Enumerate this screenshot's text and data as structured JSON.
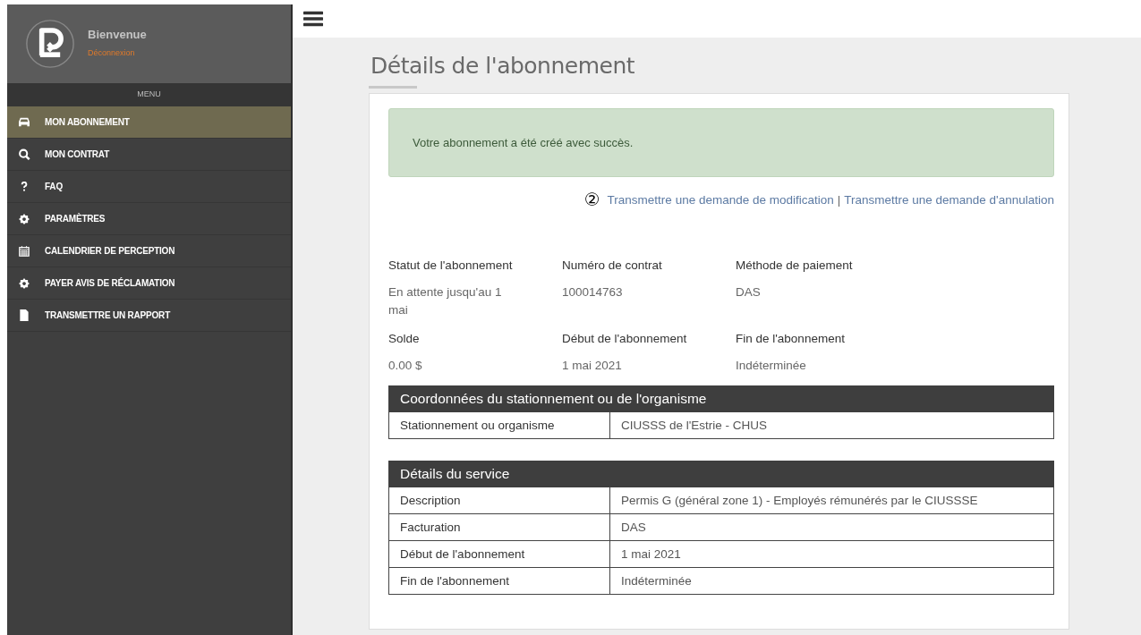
{
  "sidebar": {
    "greeting": "Bienvenue",
    "logout": "Déconnexion",
    "menu_heading": "MENU",
    "items": [
      {
        "label": "MON ABONNEMENT",
        "kind": "car",
        "selected": true
      },
      {
        "label": "MON CONTRAT",
        "kind": "search",
        "selected": false
      },
      {
        "label": "FAQ",
        "kind": "question",
        "selected": false
      },
      {
        "label": "PARAMÈTRES",
        "kind": "gear",
        "selected": false
      },
      {
        "label": "CALENDRIER DE PERCEPTION",
        "kind": "calendar",
        "selected": false
      },
      {
        "label": "PAYER AVIS DE RÉCLAMATION",
        "kind": "gear",
        "selected": false
      },
      {
        "label": "TRANSMETTRE UN RAPPORT",
        "kind": "file",
        "selected": false
      }
    ]
  },
  "page": {
    "title": "Détails de l'abonnement",
    "alert": "Votre abonnement a été créé avec succès.",
    "marker": "②",
    "links": [
      "Transmettre une demande de modification",
      "Transmettre une demande d'annulation"
    ],
    "separator": "|",
    "fields": [
      {
        "label": "Statut de l'abonnement",
        "value": "En attente jusqu'au 1 mai"
      },
      {
        "label": "Numéro de contrat",
        "value": "100014763"
      },
      {
        "label": "Méthode de paiement",
        "value": "DAS"
      },
      {
        "label": "Solde",
        "value": "0.00 $"
      },
      {
        "label": "Début de l'abonnement",
        "value": "1 mai 2021"
      },
      {
        "label": "Fin de l'abonnement",
        "value": "Indéterminée"
      }
    ],
    "tables": [
      {
        "title": "Coordonnées du stationnement ou de l'organisme",
        "rows": [
          [
            "Stationnement ou organisme",
            "CIUSSS de l'Estrie - CHUS"
          ]
        ]
      },
      {
        "title": "Détails du service",
        "rows": [
          [
            "Description",
            "Permis G (général zone 1) - Employés rémunérés par le CIUSSSE"
          ],
          [
            "Facturation",
            "DAS"
          ],
          [
            "Début de l'abonnement",
            "1 mai 2021"
          ],
          [
            "Fin de l'abonnement",
            "Indéterminée"
          ]
        ]
      }
    ]
  }
}
